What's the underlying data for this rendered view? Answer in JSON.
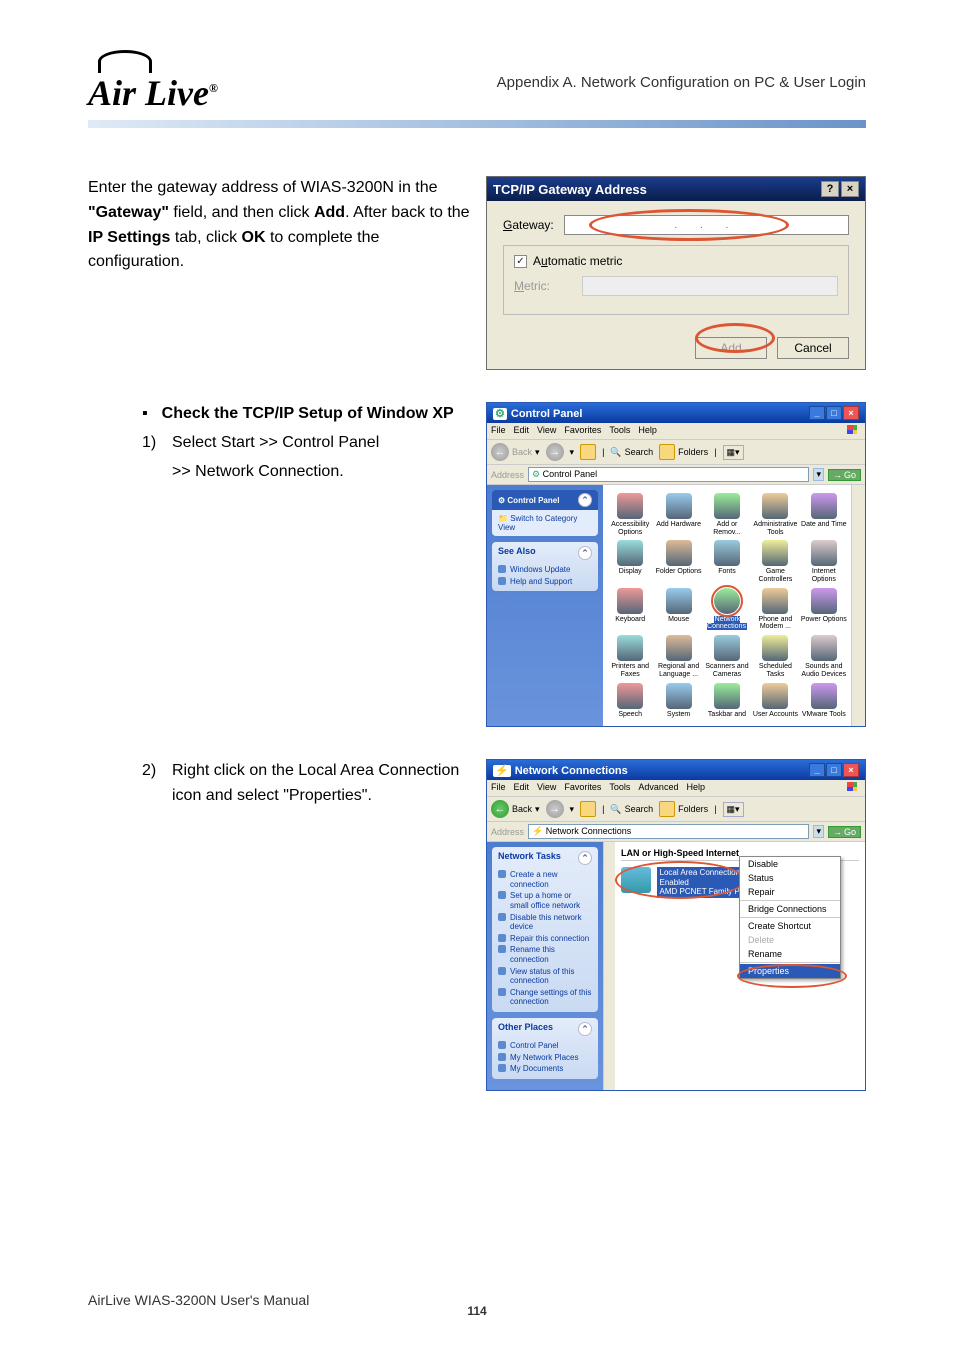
{
  "header": {
    "logo_text": "Air Live",
    "appendix_title": "Appendix A. Network Configuration on PC & User Login"
  },
  "intro": {
    "line1_pre": "Enter the gateway address of WIAS-3200N in the ",
    "gateway_bold": "\"Gateway\"",
    "line1_post": " field, and then click ",
    "add_bold": "Add",
    "line1_end": ". After back to the ",
    "ip_bold": "IP Settings",
    "line2_mid": " tab, click ",
    "ok_bold": "OK",
    "line2_end": " to complete the configuration."
  },
  "dialog_tcpip": {
    "title": "TCP/IP Gateway Address",
    "gateway_label": "Gateway:",
    "ip_dots": ".    .    .",
    "automatic_metric": "Automatic metric",
    "metric_label": "Metric:",
    "btn_add": "Add",
    "btn_cancel": "Cancel",
    "help_btn": "?",
    "close_btn": "×"
  },
  "bullet1": {
    "square": "▪",
    "text_pre": "Check the TCP/IP Setup of Window XP"
  },
  "step1": {
    "num": "1)",
    "pre": "Select ",
    "start_bold": "Start",
    "gt": " >> ",
    "cp_bold": "Control Panel",
    "gt2": " >> ",
    "nc_bold": "Network Connection",
    "period": "."
  },
  "step2": {
    "num": "2)",
    "pre": "Right click on the ",
    "lac_bold": "Local Area Connection",
    "mid": " icon and select ",
    "props_bold": "\"Properties\"",
    "period": "."
  },
  "cp_window": {
    "title": "Control Panel",
    "menus": [
      "File",
      "Edit",
      "View",
      "Favorites",
      "Tools",
      "Help"
    ],
    "back": "Back",
    "search": "Search",
    "folders": "Folders",
    "address_label": "Address",
    "address_value": "Control Panel",
    "go": "Go",
    "panel_title": "Control Panel",
    "switch_view": "Switch to Category View",
    "see_also": "See Also",
    "see_also_items": [
      "Windows Update",
      "Help and Support"
    ],
    "items": [
      "Accessibility Options",
      "Add Hardware",
      "Add or Remov...",
      "Administrative Tools",
      "Date and Time",
      "Display",
      "Folder Options",
      "Fonts",
      "Game Controllers",
      "Internet Options",
      "Keyboard",
      "Mouse",
      "Network Connections",
      "Phone and Modem ...",
      "Power Options",
      "Printers and Faxes",
      "Regional and Language ...",
      "Scanners and Cameras",
      "Scheduled Tasks",
      "Sounds and Audio Devices",
      "Speech",
      "System",
      "Taskbar and",
      "User Accounts",
      "VMware Tools"
    ]
  },
  "nc_window": {
    "title": "Network Connections",
    "menus": [
      "File",
      "Edit",
      "View",
      "Favorites",
      "Tools",
      "Advanced",
      "Help"
    ],
    "back": "Back",
    "search": "Search",
    "folders": "Folders",
    "address_label": "Address",
    "address_value": "Network Connections",
    "go": "Go",
    "section": "LAN or High-Speed Internet",
    "item_name": "Local Area Connection",
    "item_status": "Enabled",
    "item_device": "AMD PCNET Family PCI Ethern...",
    "tasks_title": "Network Tasks",
    "tasks": [
      "Create a new connection",
      "Set up a home or small office network",
      "Disable this network device",
      "Repair this connection",
      "Rename this connection",
      "View status of this connection",
      "Change settings of this connection"
    ],
    "other_places_title": "Other Places",
    "other_places": [
      "Control Panel",
      "My Network Places",
      "My Documents"
    ],
    "ctx": [
      "Disable",
      "Status",
      "Repair",
      "Bridge Connections",
      "Create Shortcut",
      "Delete",
      "Rename",
      "Properties"
    ]
  },
  "footer": {
    "manual": "AirLive WIAS-3200N User's Manual",
    "page": "114"
  }
}
